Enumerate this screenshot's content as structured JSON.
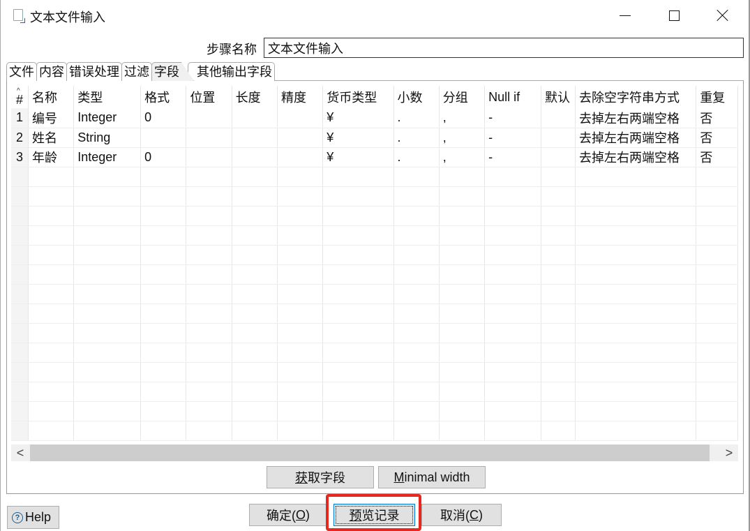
{
  "window": {
    "title": "文本文件输入",
    "controls": {
      "minimize": "minimize",
      "maximize": "maximize",
      "close": "close"
    }
  },
  "step": {
    "label": "步骤名称",
    "value": "文本文件输入"
  },
  "tabs": [
    {
      "label": "文件",
      "active": false
    },
    {
      "label": "内容",
      "active": false
    },
    {
      "label": "错误处理",
      "active": false
    },
    {
      "label": "过滤",
      "active": false
    },
    {
      "label": "字段",
      "active": true
    },
    {
      "label": "其他输出字段",
      "active": false
    }
  ],
  "table": {
    "columns": [
      "#",
      "名称",
      "类型",
      "格式",
      "位置",
      "长度",
      "精度",
      "货币类型",
      "小数",
      "分组",
      "Null if",
      "默认",
      "去除空字符串方式",
      "重复"
    ],
    "rows": [
      [
        "1",
        "编号",
        "Integer",
        "0",
        "",
        "",
        "",
        "¥",
        ".",
        ",",
        "-",
        "",
        "去掉左右两端空格",
        "否"
      ],
      [
        "2",
        "姓名",
        "String",
        "",
        "",
        "",
        "",
        "¥",
        ".",
        ",",
        "-",
        "",
        "去掉左右两端空格",
        "否"
      ],
      [
        "3",
        "年龄",
        "Integer",
        "0",
        "",
        "",
        "",
        "¥",
        ".",
        ",",
        "-",
        "",
        "去掉左右两端空格",
        "否"
      ]
    ],
    "empty_rows": 14
  },
  "scrollbar": {
    "left": "<",
    "right": ">"
  },
  "buttons": {
    "get_fields": {
      "pre": "",
      "mnemonic": "获",
      "post": "取字段"
    },
    "minimal_width": {
      "pre": "",
      "mnemonic": "M",
      "post": "inimal width"
    },
    "ok": {
      "pre": "确定(",
      "mnemonic": "O",
      "post": ")"
    },
    "preview": {
      "pre": "",
      "mnemonic": "预",
      "post": "览记录"
    },
    "cancel": {
      "pre": "取消(",
      "mnemonic": "C",
      "post": ")"
    },
    "help": "Help"
  },
  "icons": {
    "help": "?"
  },
  "colors": {
    "highlight": "#e8281e",
    "focus": "#0078d7"
  }
}
